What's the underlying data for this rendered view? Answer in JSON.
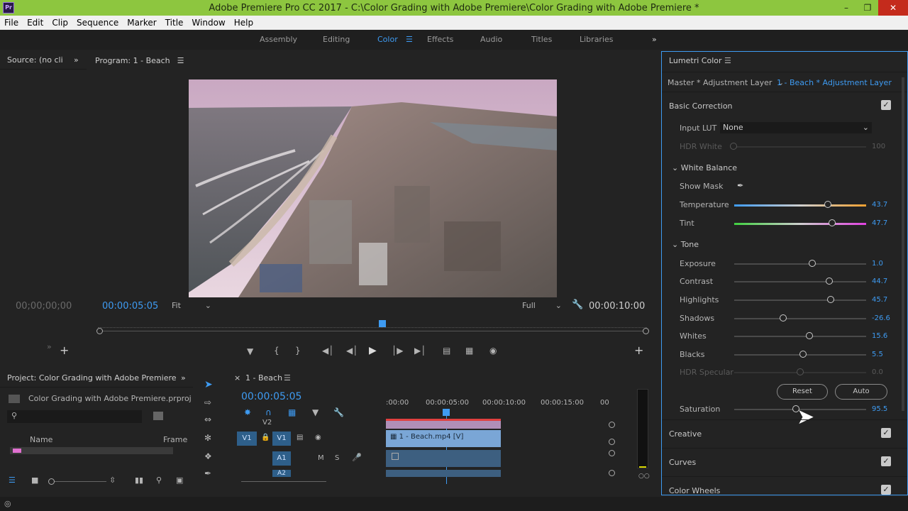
{
  "window": {
    "title": "Adobe Premiere Pro CC 2017 - C:\\Color Grading with Adobe Premiere\\Color Grading with Adobe Premiere *",
    "app_icon": "Pr"
  },
  "menu": [
    "File",
    "Edit",
    "Clip",
    "Sequence",
    "Marker",
    "Title",
    "Window",
    "Help"
  ],
  "workspaces": [
    "Assembly",
    "Editing",
    "Color",
    "Effects",
    "Audio",
    "Titles",
    "Libraries"
  ],
  "workspace_active": "Color",
  "source": {
    "tab": "Source: (no cli",
    "timecode": "00;00;00;00"
  },
  "program": {
    "tab": "Program: 1 - Beach",
    "timecode": "00:00:05:05",
    "fit": "Fit",
    "quality": "Full",
    "duration": "00:00:10:00"
  },
  "lumetri": {
    "tab": "Lumetri Color",
    "master": "Master * Adjustment Layer",
    "clip": "1 - Beach * Adjustment Layer",
    "basic_correction": "Basic Correction",
    "input_lut_label": "Input LUT",
    "input_lut_value": "None",
    "hdr_white_label": "HDR White",
    "hdr_white_value": "100",
    "white_balance": "White Balance",
    "show_mask": "Show Mask",
    "temperature": {
      "label": "Temperature",
      "value": "43.7",
      "level": 0.71
    },
    "tint": {
      "label": "Tint",
      "value": "47.7",
      "level": 0.74
    },
    "tone": "Tone",
    "exposure": {
      "label": "Exposure",
      "value": "1.0",
      "level": 0.59
    },
    "contrast": {
      "label": "Contrast",
      "value": "44.7",
      "level": 0.72
    },
    "highlights": {
      "label": "Highlights",
      "value": "45.7",
      "level": 0.73
    },
    "shadows": {
      "label": "Shadows",
      "value": "-26.6",
      "level": 0.37
    },
    "whites": {
      "label": "Whites",
      "value": "15.6",
      "level": 0.57
    },
    "blacks": {
      "label": "Blacks",
      "value": "5.5",
      "level": 0.52
    },
    "hdr_specular": {
      "label": "HDR Specular",
      "value": "0.0",
      "level": 0.5
    },
    "reset": "Reset",
    "auto": "Auto",
    "saturation": {
      "label": "Saturation",
      "value": "95.5",
      "level": 0.47
    },
    "creative": "Creative",
    "curves": "Curves",
    "color_wheels": "Color Wheels"
  },
  "project": {
    "tab": "Project: Color Grading with Adobe Premiere",
    "file": "Color Grading with Adobe Premiere.prproj",
    "col_name": "Name",
    "col_frame": "Frame"
  },
  "timeline": {
    "tab": "1 - Beach",
    "timecode": "00:00:05:05",
    "ruler": [
      ":00:00",
      "00:00:05:00",
      "00:00:10:00",
      "00:00:15:00",
      "00"
    ],
    "tracks": [
      "V2",
      "V1",
      "A1",
      "A2"
    ],
    "source_patch": "V1",
    "clip_v1": "1 - Beach.mp4 [V]",
    "track_m": "M",
    "track_s": "S"
  },
  "colors": {
    "accent": "#3e9bf2",
    "titlebar": "#8dc63f",
    "clip": "#7aa6d6"
  }
}
